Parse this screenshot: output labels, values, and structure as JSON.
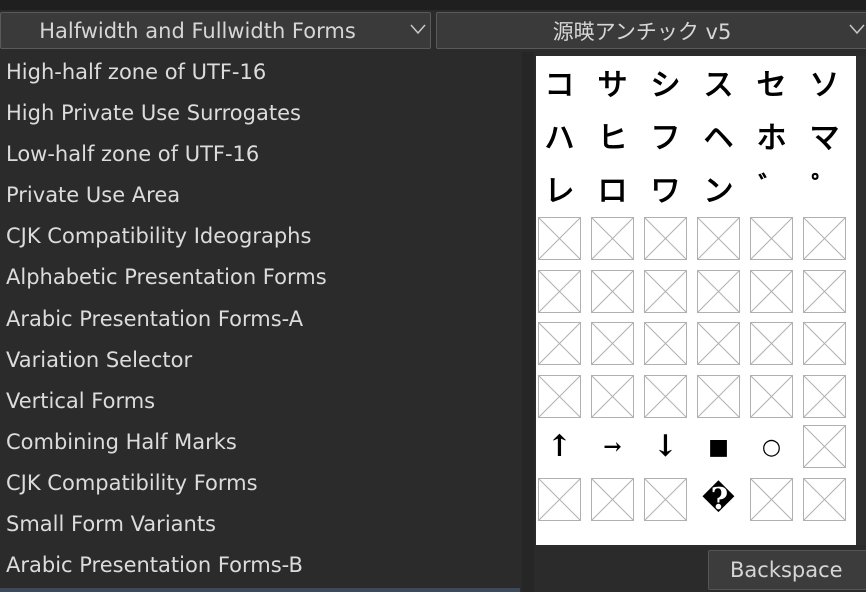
{
  "block_dropdown": {
    "value": "Halfwidth and Fullwidth Forms"
  },
  "font_dropdown": {
    "value": "源暎アンチック v5"
  },
  "block_list": {
    "items": [
      "High-half zone of UTF-16",
      "High Private Use Surrogates",
      "Low-half zone of UTF-16",
      "Private Use Area",
      "CJK Compatibility Ideographs",
      "Alphabetic Presentation Forms",
      "Arabic Presentation Forms-A",
      "Variation Selector",
      "Vertical Forms",
      "Combining Half Marks",
      "CJK Compatibility Forms",
      "Small Form Variants",
      "Arabic Presentation Forms-B"
    ]
  },
  "glyph_grid": {
    "rows": [
      [
        "コ",
        "サ",
        "シ",
        "ス",
        "セ",
        "ソ"
      ],
      [
        "ハ",
        "ヒ",
        "フ",
        "ヘ",
        "ホ",
        "マ"
      ],
      [
        "レ",
        "ロ",
        "ワ",
        "ン",
        "゛",
        "゜"
      ],
      [
        "",
        "",
        "",
        "",
        "",
        ""
      ],
      [
        "",
        "",
        "",
        "",
        "",
        ""
      ],
      [
        "",
        "",
        "",
        "",
        "",
        ""
      ],
      [
        "",
        "",
        "",
        "",
        "",
        ""
      ],
      [
        "↑",
        "→",
        "↓",
        "■",
        "○",
        ""
      ],
      [
        "",
        "",
        "",
        "�",
        "",
        ""
      ]
    ]
  },
  "backspace_button": {
    "label": "Backspace"
  }
}
